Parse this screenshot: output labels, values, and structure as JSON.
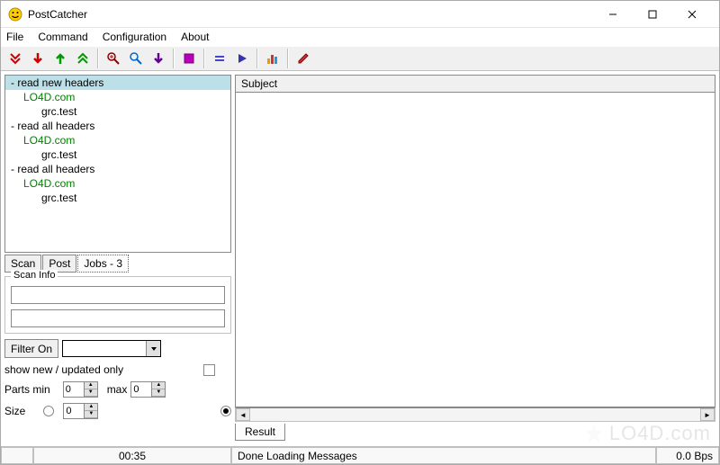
{
  "title": "PostCatcher",
  "menubar": [
    "File",
    "Command",
    "Configuration",
    "About"
  ],
  "toolbar_icons": [
    "double-down-red-icon",
    "down-red-icon",
    "up-green-icon",
    "double-up-green-icon",
    "sep",
    "zoom-in-icon",
    "zoom-icon",
    "down-purple-icon",
    "sep",
    "stop-icon",
    "sep",
    "equals-icon",
    "play-icon",
    "sep",
    "bars-icon",
    "sep",
    "pencil-icon"
  ],
  "tree": [
    {
      "level": 0,
      "text": "- read new headers",
      "selected": true
    },
    {
      "level": 1,
      "text": "LO4D.com"
    },
    {
      "level": 2,
      "text": "grc.test"
    },
    {
      "level": 0,
      "text": "- read all headers"
    },
    {
      "level": 1,
      "text": "LO4D.com"
    },
    {
      "level": 2,
      "text": "grc.test"
    },
    {
      "level": 0,
      "text": "- read all headers"
    },
    {
      "level": 1,
      "text": "LO4D.com"
    },
    {
      "level": 2,
      "text": "grc.test"
    }
  ],
  "left_tabs": {
    "scan": "Scan",
    "post": "Post",
    "jobs": "Jobs - 3",
    "active": "jobs"
  },
  "scan_info": {
    "legend": "Scan Info"
  },
  "filter_btn": "Filter On",
  "show_new_label": "show new / updated only",
  "parts": {
    "min_label": "Parts min",
    "min": "0",
    "max_label": "max",
    "max": "0"
  },
  "size": {
    "label": "Size",
    "value": "0"
  },
  "subject_header": "Subject",
  "result_tab": "Result",
  "statusbar": {
    "time": "00:35",
    "msg": "Done Loading Messages",
    "bps": "0.0 Bps"
  },
  "watermark": "LO4D.com"
}
